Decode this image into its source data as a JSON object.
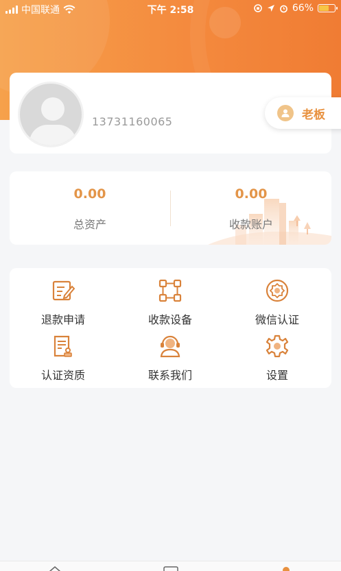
{
  "status_bar": {
    "carrier": "中国联通",
    "time": "下午 2:58",
    "battery_percent": "66%",
    "battery_level": 0.66,
    "battery_color": "#f7c445"
  },
  "profile": {
    "phone": "13731160065",
    "avatar_icon": "default-avatar-icon",
    "role_badge": {
      "label": "老板",
      "icon": "user-badge-icon"
    }
  },
  "assets": {
    "total": {
      "value": "0.00",
      "label": "总资产"
    },
    "receipt": {
      "value": "0.00",
      "label": "收款账户"
    }
  },
  "menu": {
    "items": [
      {
        "label": "退款申请",
        "icon": "refund-edit-icon"
      },
      {
        "label": "收款设备",
        "icon": "device-network-icon"
      },
      {
        "label": "微信认证",
        "icon": "certification-seal-icon"
      },
      {
        "label": "认证资质",
        "icon": "qualification-doc-icon"
      },
      {
        "label": "联系我们",
        "icon": "customer-service-icon"
      },
      {
        "label": "设置",
        "icon": "gear-icon"
      }
    ]
  },
  "colors": {
    "accent": "#e8913f",
    "header_gradient_start": "#f6a14b",
    "header_gradient_end": "#f07c33",
    "amount": "#e39549"
  }
}
